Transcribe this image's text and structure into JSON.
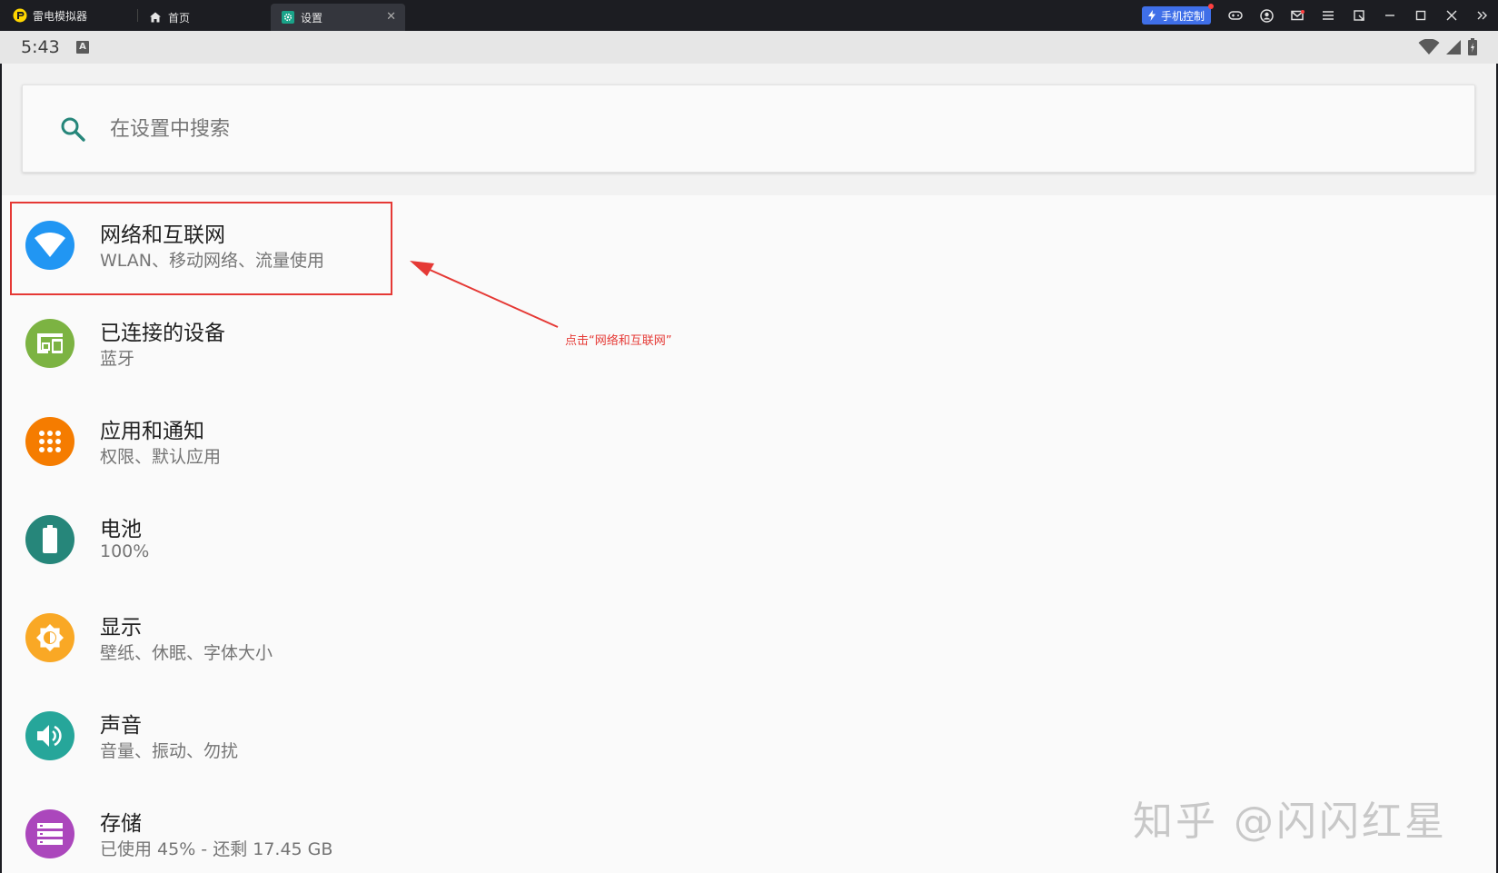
{
  "window": {
    "app_name": "雷电模拟器",
    "tabs": [
      {
        "label": "首页",
        "icon": "home-icon"
      },
      {
        "label": "设置",
        "icon": "gear-icon",
        "active": true
      }
    ],
    "phone_control_label": "手机控制",
    "controls": [
      "gamepad-icon",
      "account-icon",
      "mail-icon",
      "menu-icon",
      "restore-icon",
      "minimize-icon",
      "maximize-icon",
      "close-icon",
      "expand-icon"
    ]
  },
  "status_bar": {
    "time": "5:43",
    "badge": "A"
  },
  "search": {
    "placeholder": "在设置中搜索"
  },
  "settings": [
    {
      "title": "网络和互联网",
      "subtitle": "WLAN、移动网络、流量使用",
      "icon": "wifi-icon",
      "color": "#2196f3"
    },
    {
      "title": "已连接的设备",
      "subtitle": "蓝牙",
      "icon": "devices-icon",
      "color": "#7cb342"
    },
    {
      "title": "应用和通知",
      "subtitle": "权限、默认应用",
      "icon": "apps-icon",
      "color": "#f57c00"
    },
    {
      "title": "电池",
      "subtitle": "100%",
      "icon": "battery-icon",
      "color": "#26867a"
    },
    {
      "title": "显示",
      "subtitle": "壁纸、休眠、字体大小",
      "icon": "brightness-icon",
      "color": "#f9a825"
    },
    {
      "title": "声音",
      "subtitle": "音量、振动、勿扰",
      "icon": "volume-icon",
      "color": "#26a69a"
    },
    {
      "title": "存储",
      "subtitle": "已使用 45% - 还剩 17.45 GB",
      "icon": "storage-icon",
      "color": "#ab47bc"
    }
  ],
  "annotation": {
    "text": "点击“网络和互联网”",
    "color": "#e53935"
  },
  "watermark": "知乎 @闪闪红星"
}
